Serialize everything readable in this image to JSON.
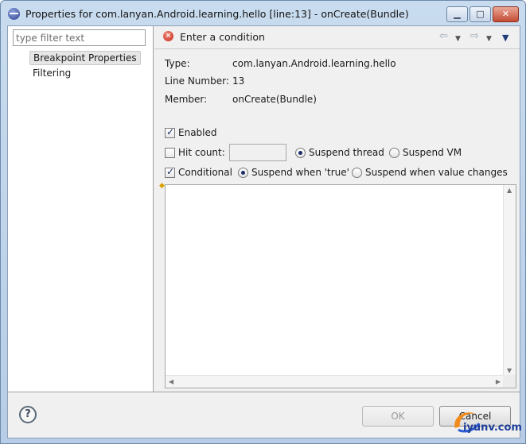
{
  "window": {
    "title": "Properties for com.lanyan.Android.learning.hello [line:13] - onCreate(Bundle)",
    "min_icon": "minimize-icon",
    "max_icon": "maximize-icon",
    "close_icon": "close-icon"
  },
  "sidebar": {
    "filter_placeholder": "type filter text",
    "filter_value": "",
    "items": [
      {
        "label": "Breakpoint Properties",
        "selected": true
      },
      {
        "label": "Filtering",
        "selected": false
      }
    ]
  },
  "header": {
    "message": "Enter a condition",
    "icons": [
      "error-icon",
      "back-arrow-icon",
      "forward-arrow-icon",
      "view-menu-icon"
    ]
  },
  "properties": {
    "type_label": "Type:",
    "type_value": "com.lanyan.Android.learning.hello",
    "line_label": "Line Number:",
    "line_value": "13",
    "member_label": "Member:",
    "member_value": "onCreate(Bundle)"
  },
  "options": {
    "enabled_label": "Enabled",
    "enabled_checked": true,
    "hit_count_label": "Hit count:",
    "hit_count_checked": false,
    "hit_count_value": "",
    "suspend_thread_label": "Suspend thread",
    "suspend_thread_selected": true,
    "suspend_vm_label": "Suspend VM",
    "suspend_vm_selected": false,
    "conditional_label": "Conditional",
    "conditional_checked": true,
    "suspend_true_label": "Suspend when 'true'",
    "suspend_true_selected": true,
    "suspend_changes_label": "Suspend when value changes",
    "suspend_changes_selected": false
  },
  "editor": {
    "content": ""
  },
  "footer": {
    "ok_label": "OK",
    "ok_enabled": false,
    "cancel_label": "Cancel"
  },
  "watermark": {
    "text": "iyunv.com"
  },
  "colors": {
    "titlebar": "#c9dcef",
    "dialog_bg": "#f0f0f0",
    "accent": "#1b2e6b",
    "error": "#c8261a"
  }
}
